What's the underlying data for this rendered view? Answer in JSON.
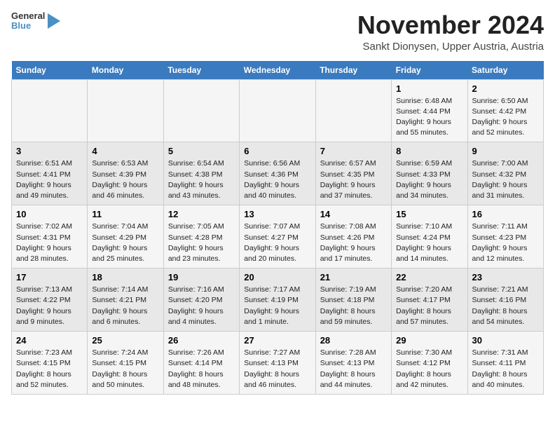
{
  "logo": {
    "line1": "General",
    "line2": "Blue"
  },
  "title": "November 2024",
  "subtitle": "Sankt Dionysen, Upper Austria, Austria",
  "days_of_week": [
    "Sunday",
    "Monday",
    "Tuesday",
    "Wednesday",
    "Thursday",
    "Friday",
    "Saturday"
  ],
  "weeks": [
    [
      {
        "day": "",
        "info": ""
      },
      {
        "day": "",
        "info": ""
      },
      {
        "day": "",
        "info": ""
      },
      {
        "day": "",
        "info": ""
      },
      {
        "day": "",
        "info": ""
      },
      {
        "day": "1",
        "info": "Sunrise: 6:48 AM\nSunset: 4:44 PM\nDaylight: 9 hours\nand 55 minutes."
      },
      {
        "day": "2",
        "info": "Sunrise: 6:50 AM\nSunset: 4:42 PM\nDaylight: 9 hours\nand 52 minutes."
      }
    ],
    [
      {
        "day": "3",
        "info": "Sunrise: 6:51 AM\nSunset: 4:41 PM\nDaylight: 9 hours\nand 49 minutes."
      },
      {
        "day": "4",
        "info": "Sunrise: 6:53 AM\nSunset: 4:39 PM\nDaylight: 9 hours\nand 46 minutes."
      },
      {
        "day": "5",
        "info": "Sunrise: 6:54 AM\nSunset: 4:38 PM\nDaylight: 9 hours\nand 43 minutes."
      },
      {
        "day": "6",
        "info": "Sunrise: 6:56 AM\nSunset: 4:36 PM\nDaylight: 9 hours\nand 40 minutes."
      },
      {
        "day": "7",
        "info": "Sunrise: 6:57 AM\nSunset: 4:35 PM\nDaylight: 9 hours\nand 37 minutes."
      },
      {
        "day": "8",
        "info": "Sunrise: 6:59 AM\nSunset: 4:33 PM\nDaylight: 9 hours\nand 34 minutes."
      },
      {
        "day": "9",
        "info": "Sunrise: 7:00 AM\nSunset: 4:32 PM\nDaylight: 9 hours\nand 31 minutes."
      }
    ],
    [
      {
        "day": "10",
        "info": "Sunrise: 7:02 AM\nSunset: 4:31 PM\nDaylight: 9 hours\nand 28 minutes."
      },
      {
        "day": "11",
        "info": "Sunrise: 7:04 AM\nSunset: 4:29 PM\nDaylight: 9 hours\nand 25 minutes."
      },
      {
        "day": "12",
        "info": "Sunrise: 7:05 AM\nSunset: 4:28 PM\nDaylight: 9 hours\nand 23 minutes."
      },
      {
        "day": "13",
        "info": "Sunrise: 7:07 AM\nSunset: 4:27 PM\nDaylight: 9 hours\nand 20 minutes."
      },
      {
        "day": "14",
        "info": "Sunrise: 7:08 AM\nSunset: 4:26 PM\nDaylight: 9 hours\nand 17 minutes."
      },
      {
        "day": "15",
        "info": "Sunrise: 7:10 AM\nSunset: 4:24 PM\nDaylight: 9 hours\nand 14 minutes."
      },
      {
        "day": "16",
        "info": "Sunrise: 7:11 AM\nSunset: 4:23 PM\nDaylight: 9 hours\nand 12 minutes."
      }
    ],
    [
      {
        "day": "17",
        "info": "Sunrise: 7:13 AM\nSunset: 4:22 PM\nDaylight: 9 hours\nand 9 minutes."
      },
      {
        "day": "18",
        "info": "Sunrise: 7:14 AM\nSunset: 4:21 PM\nDaylight: 9 hours\nand 6 minutes."
      },
      {
        "day": "19",
        "info": "Sunrise: 7:16 AM\nSunset: 4:20 PM\nDaylight: 9 hours\nand 4 minutes."
      },
      {
        "day": "20",
        "info": "Sunrise: 7:17 AM\nSunset: 4:19 PM\nDaylight: 9 hours\nand 1 minute."
      },
      {
        "day": "21",
        "info": "Sunrise: 7:19 AM\nSunset: 4:18 PM\nDaylight: 8 hours\nand 59 minutes."
      },
      {
        "day": "22",
        "info": "Sunrise: 7:20 AM\nSunset: 4:17 PM\nDaylight: 8 hours\nand 57 minutes."
      },
      {
        "day": "23",
        "info": "Sunrise: 7:21 AM\nSunset: 4:16 PM\nDaylight: 8 hours\nand 54 minutes."
      }
    ],
    [
      {
        "day": "24",
        "info": "Sunrise: 7:23 AM\nSunset: 4:15 PM\nDaylight: 8 hours\nand 52 minutes."
      },
      {
        "day": "25",
        "info": "Sunrise: 7:24 AM\nSunset: 4:15 PM\nDaylight: 8 hours\nand 50 minutes."
      },
      {
        "day": "26",
        "info": "Sunrise: 7:26 AM\nSunset: 4:14 PM\nDaylight: 8 hours\nand 48 minutes."
      },
      {
        "day": "27",
        "info": "Sunrise: 7:27 AM\nSunset: 4:13 PM\nDaylight: 8 hours\nand 46 minutes."
      },
      {
        "day": "28",
        "info": "Sunrise: 7:28 AM\nSunset: 4:13 PM\nDaylight: 8 hours\nand 44 minutes."
      },
      {
        "day": "29",
        "info": "Sunrise: 7:30 AM\nSunset: 4:12 PM\nDaylight: 8 hours\nand 42 minutes."
      },
      {
        "day": "30",
        "info": "Sunrise: 7:31 AM\nSunset: 4:11 PM\nDaylight: 8 hours\nand 40 minutes."
      }
    ]
  ]
}
